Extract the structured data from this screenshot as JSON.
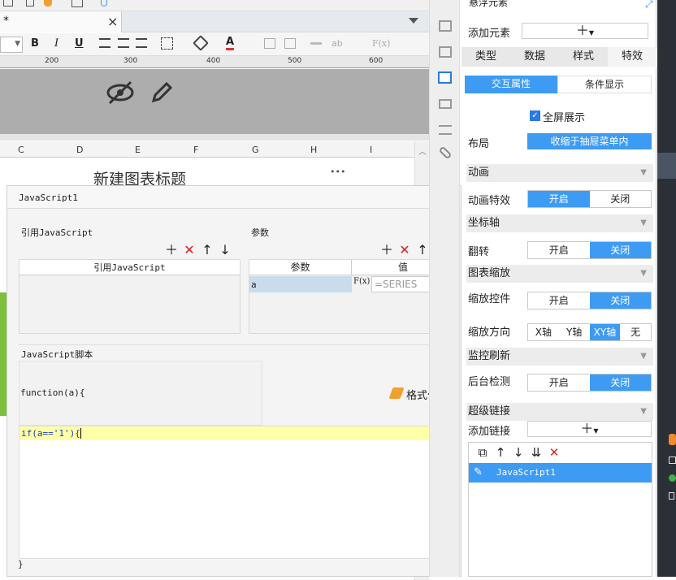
{
  "editor": {
    "tab_marker": "*",
    "close_glyph": "×",
    "ruler": [
      "200",
      "300",
      "400",
      "500",
      "600"
    ],
    "columns": [
      "C",
      "D",
      "E",
      "F",
      "G",
      "H",
      "I"
    ],
    "chart_title": "新建图表标题",
    "more_glyph": "•••"
  },
  "dialog": {
    "title": "JavaScript1",
    "ref_section": "引用JavaScript",
    "ref_col": "引用JavaScript",
    "param_section": "参数",
    "param_col": "参数",
    "value_col": "值",
    "param_name": "a",
    "fx_label": "F(x)",
    "param_value": "=SERIES",
    "script_section": "JavaScript脚本",
    "code_line1": "function(a){",
    "code_line2": "if(a=='1'){",
    "code_end": "}",
    "format_button": "格式化代码"
  },
  "panel": {
    "top_label": "悬浮元素",
    "add_element": "添加元素",
    "tabs": [
      "类型",
      "数据",
      "样式",
      "特效"
    ],
    "subtabs": [
      "交互属性",
      "条件显示"
    ],
    "fullscreen": "全屏展示",
    "layout_label": "布局",
    "layout_value": "收缩于抽屉菜单内",
    "sections": {
      "animation": "动画",
      "axis": "坐标轴",
      "zoom": "图表缩放",
      "monitor": "监控刷新",
      "hyperlink": "超级链接"
    },
    "anim_effect": "动画特效",
    "flip": "翻转",
    "zoom_ctrl": "缩放控件",
    "zoom_dir": "缩放方向",
    "bg_check": "后台检测",
    "add_link": "添加链接",
    "on": "开启",
    "off": "关闭",
    "dir_opts": [
      "X轴",
      "Y轴",
      "XY轴",
      "无"
    ],
    "link_item": "JavaScript1"
  }
}
